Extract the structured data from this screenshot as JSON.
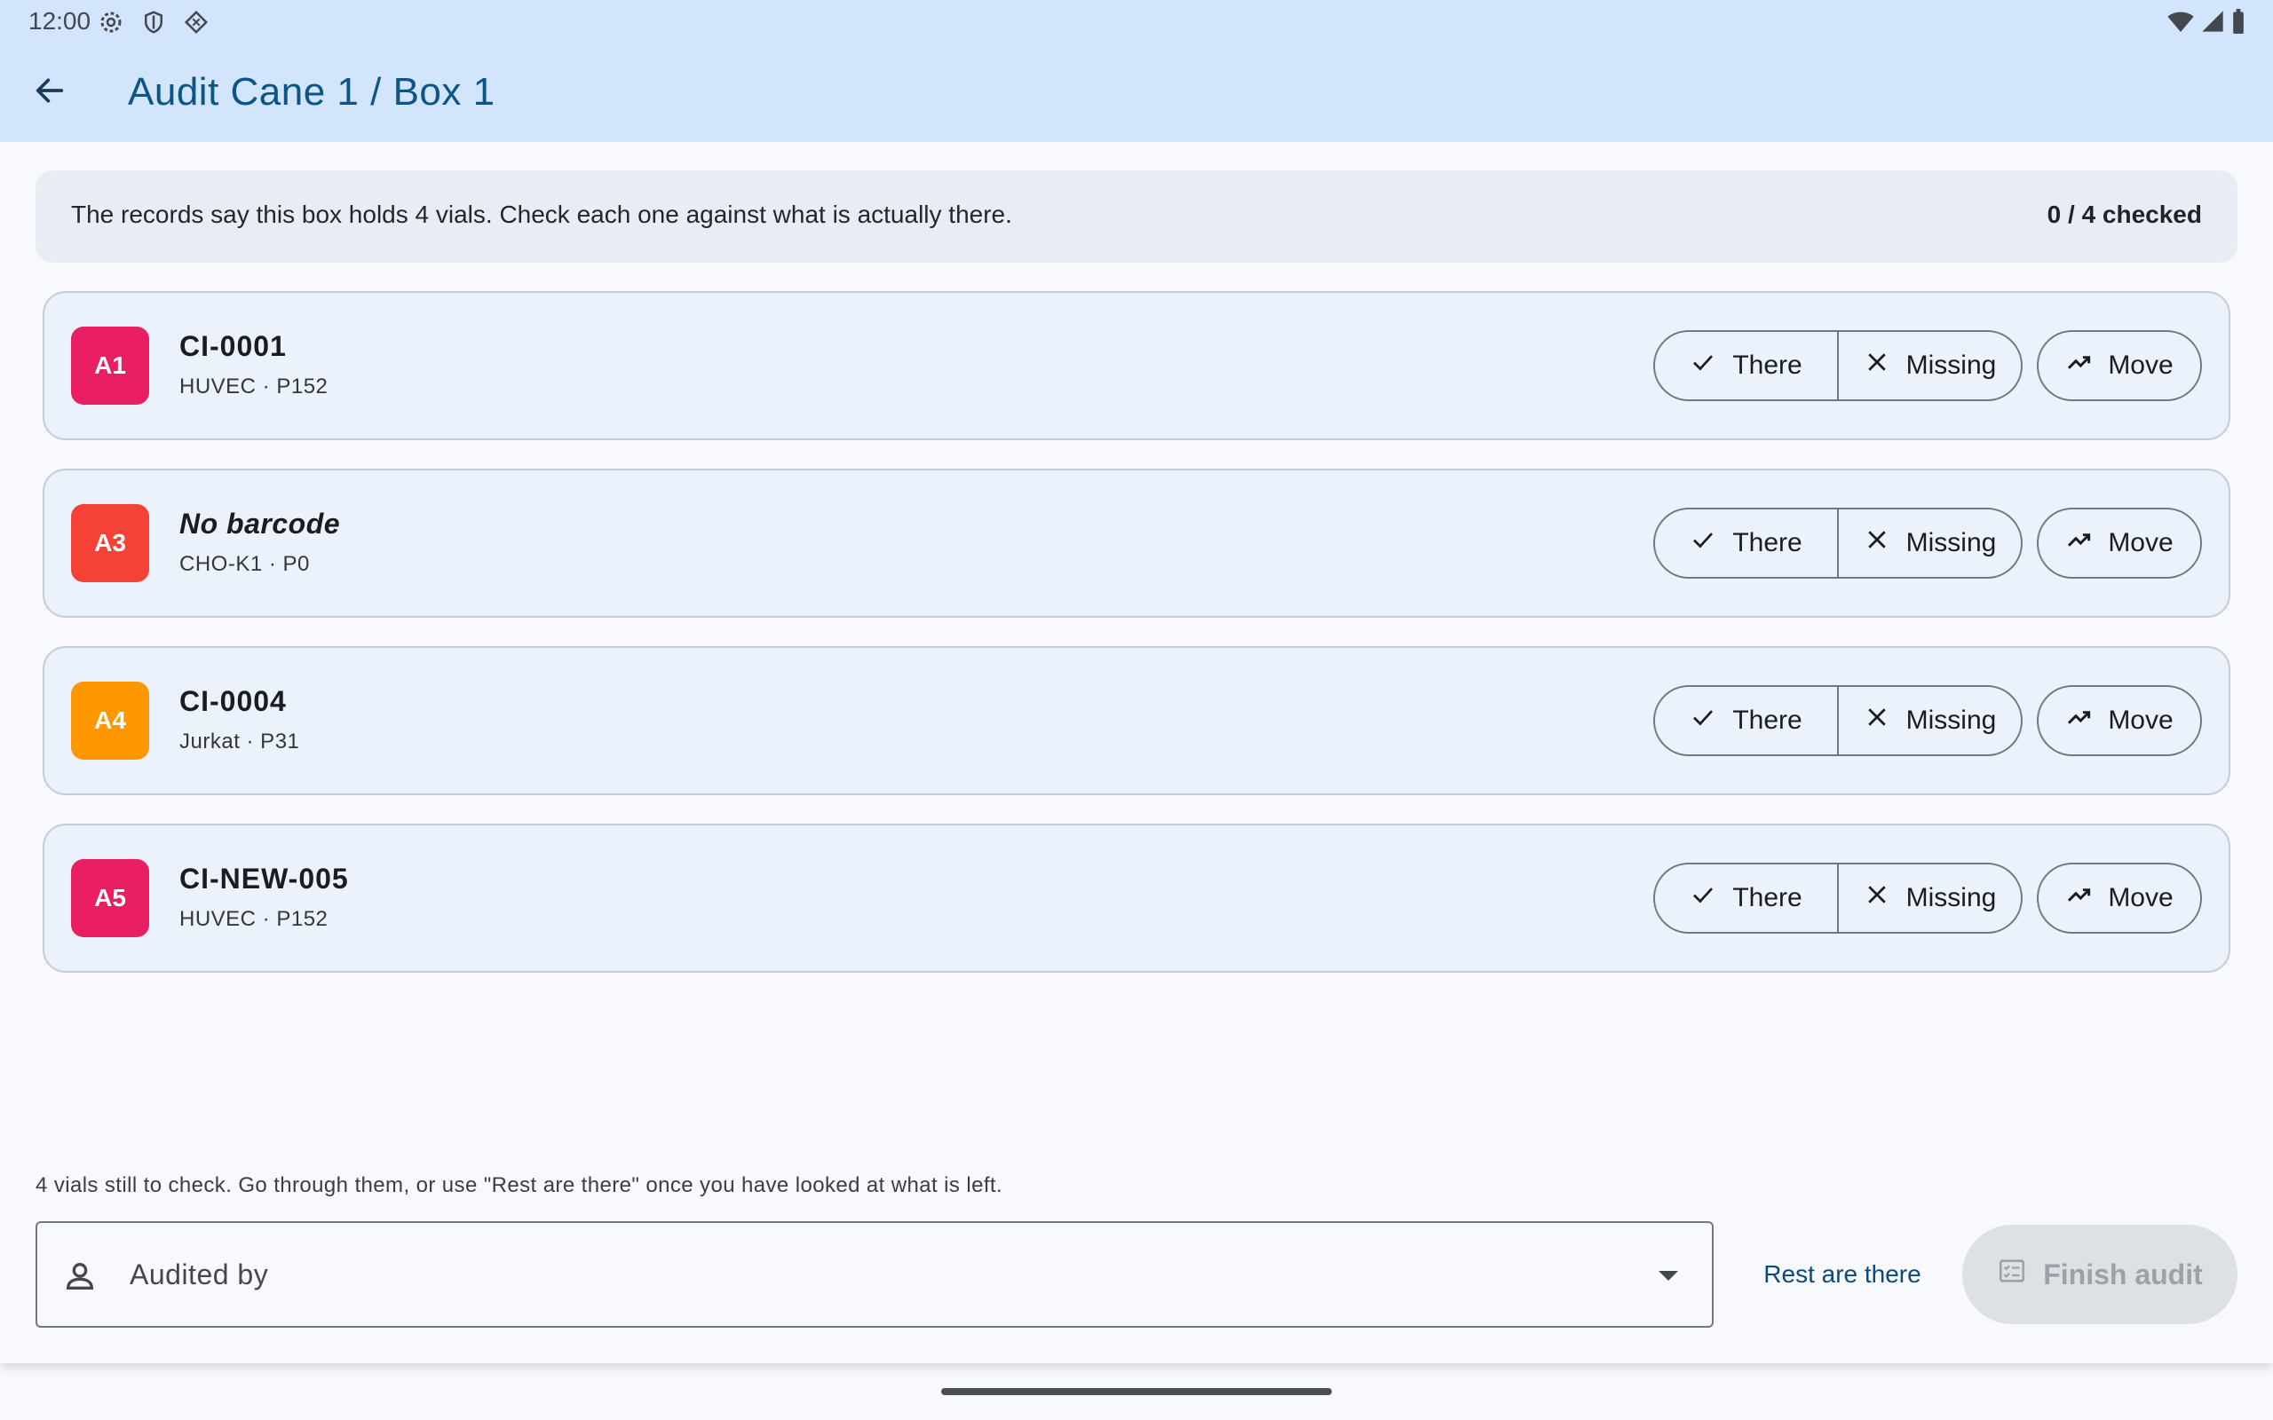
{
  "status_bar": {
    "time": "12:00"
  },
  "app_bar": {
    "title": "Audit Cane 1 / Box 1"
  },
  "banner": {
    "text": "The records say this box holds 4 vials. Check each one against what is actually there.",
    "count": "0 / 4 checked"
  },
  "vials": [
    {
      "position": "A1",
      "title": "CI-0001",
      "subtitle": "HUVEC · P152",
      "color": "#e91e63",
      "italic": false
    },
    {
      "position": "A3",
      "title": "No barcode",
      "subtitle": "CHO-K1 · P0",
      "color": "#f44336",
      "italic": true
    },
    {
      "position": "A4",
      "title": "CI-0004",
      "subtitle": "Jurkat · P31",
      "color": "#ff9800",
      "italic": false
    },
    {
      "position": "A5",
      "title": "CI-NEW-005",
      "subtitle": "HUVEC · P152",
      "color": "#e91e63",
      "italic": false
    }
  ],
  "actions": {
    "there": "There",
    "missing": "Missing",
    "move": "Move"
  },
  "bottom": {
    "hint": "4 vials still to check. Go through them, or use \"Rest are there\" once you have looked at what is left.",
    "auditor_label": "Audited by",
    "rest_button": "Rest are there",
    "finish_button": "Finish audit"
  },
  "icons": {
    "status_left": [
      "gear-icon",
      "shield-icon",
      "diamond-icon"
    ],
    "status_right": [
      "wifi-icon",
      "signal-icon",
      "battery-icon"
    ],
    "back": "arrow-back-icon",
    "there": "check-icon",
    "missing": "close-icon",
    "move": "trending-up-icon",
    "auditor": "person-icon",
    "finish": "checklist-icon"
  }
}
